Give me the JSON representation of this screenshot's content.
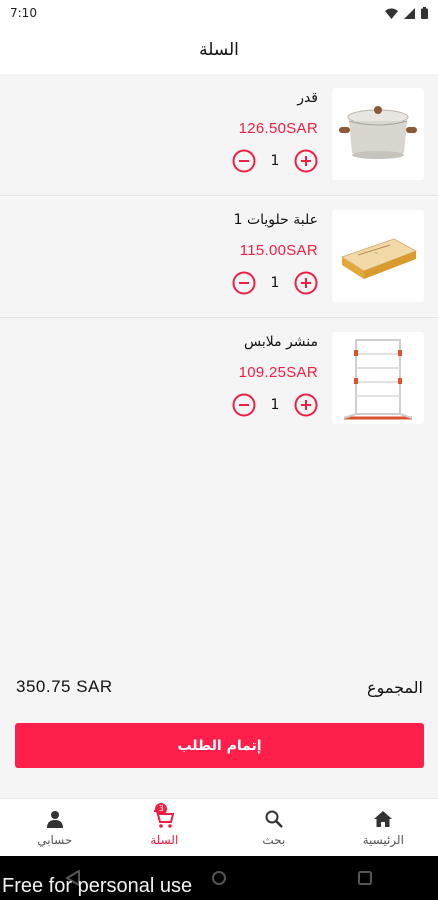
{
  "status_bar": {
    "time": "7:10"
  },
  "header": {
    "title": "السلة"
  },
  "cart": {
    "items": [
      {
        "name": "قدر",
        "price": "126.50SAR",
        "quantity": "1",
        "image": "cooking-pot"
      },
      {
        "name": "علبة حلويات 1",
        "price": "115.00SAR",
        "quantity": "1",
        "image": "sweets-box"
      },
      {
        "name": "منشر ملابس",
        "price": "109.25SAR",
        "quantity": "1",
        "image": "clothes-drying-rack"
      }
    ]
  },
  "total": {
    "label": "المجموع",
    "amount": "350.75 SAR"
  },
  "checkout": {
    "label": "إتمام الطلب"
  },
  "bottom_nav": {
    "items": [
      {
        "label": "حسابي",
        "icon": "person-icon"
      },
      {
        "label": "السلة",
        "icon": "cart-icon",
        "badge": "3",
        "active": true
      },
      {
        "label": "بحث",
        "icon": "search-icon"
      },
      {
        "label": "الرئيسية",
        "icon": "home-icon"
      }
    ]
  },
  "watermark": "Free for personal use",
  "colors": {
    "accent": "#ef1f44",
    "button": "#ff1f4a",
    "background": "#f5f5f5"
  }
}
